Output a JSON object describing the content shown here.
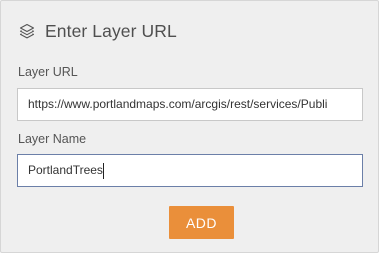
{
  "header": {
    "title": "Enter Layer URL",
    "icon": "layers-icon"
  },
  "form": {
    "url_label": "Layer URL",
    "url_value": "https://www.portlandmaps.com/arcgis/rest/services/Publi",
    "name_label": "Layer Name",
    "name_value": "PortlandTrees",
    "add_label": "ADD"
  },
  "colors": {
    "panel_bg": "#efefef",
    "accent_button": "#ea8f3a",
    "focused_border": "#6b7fa8"
  }
}
